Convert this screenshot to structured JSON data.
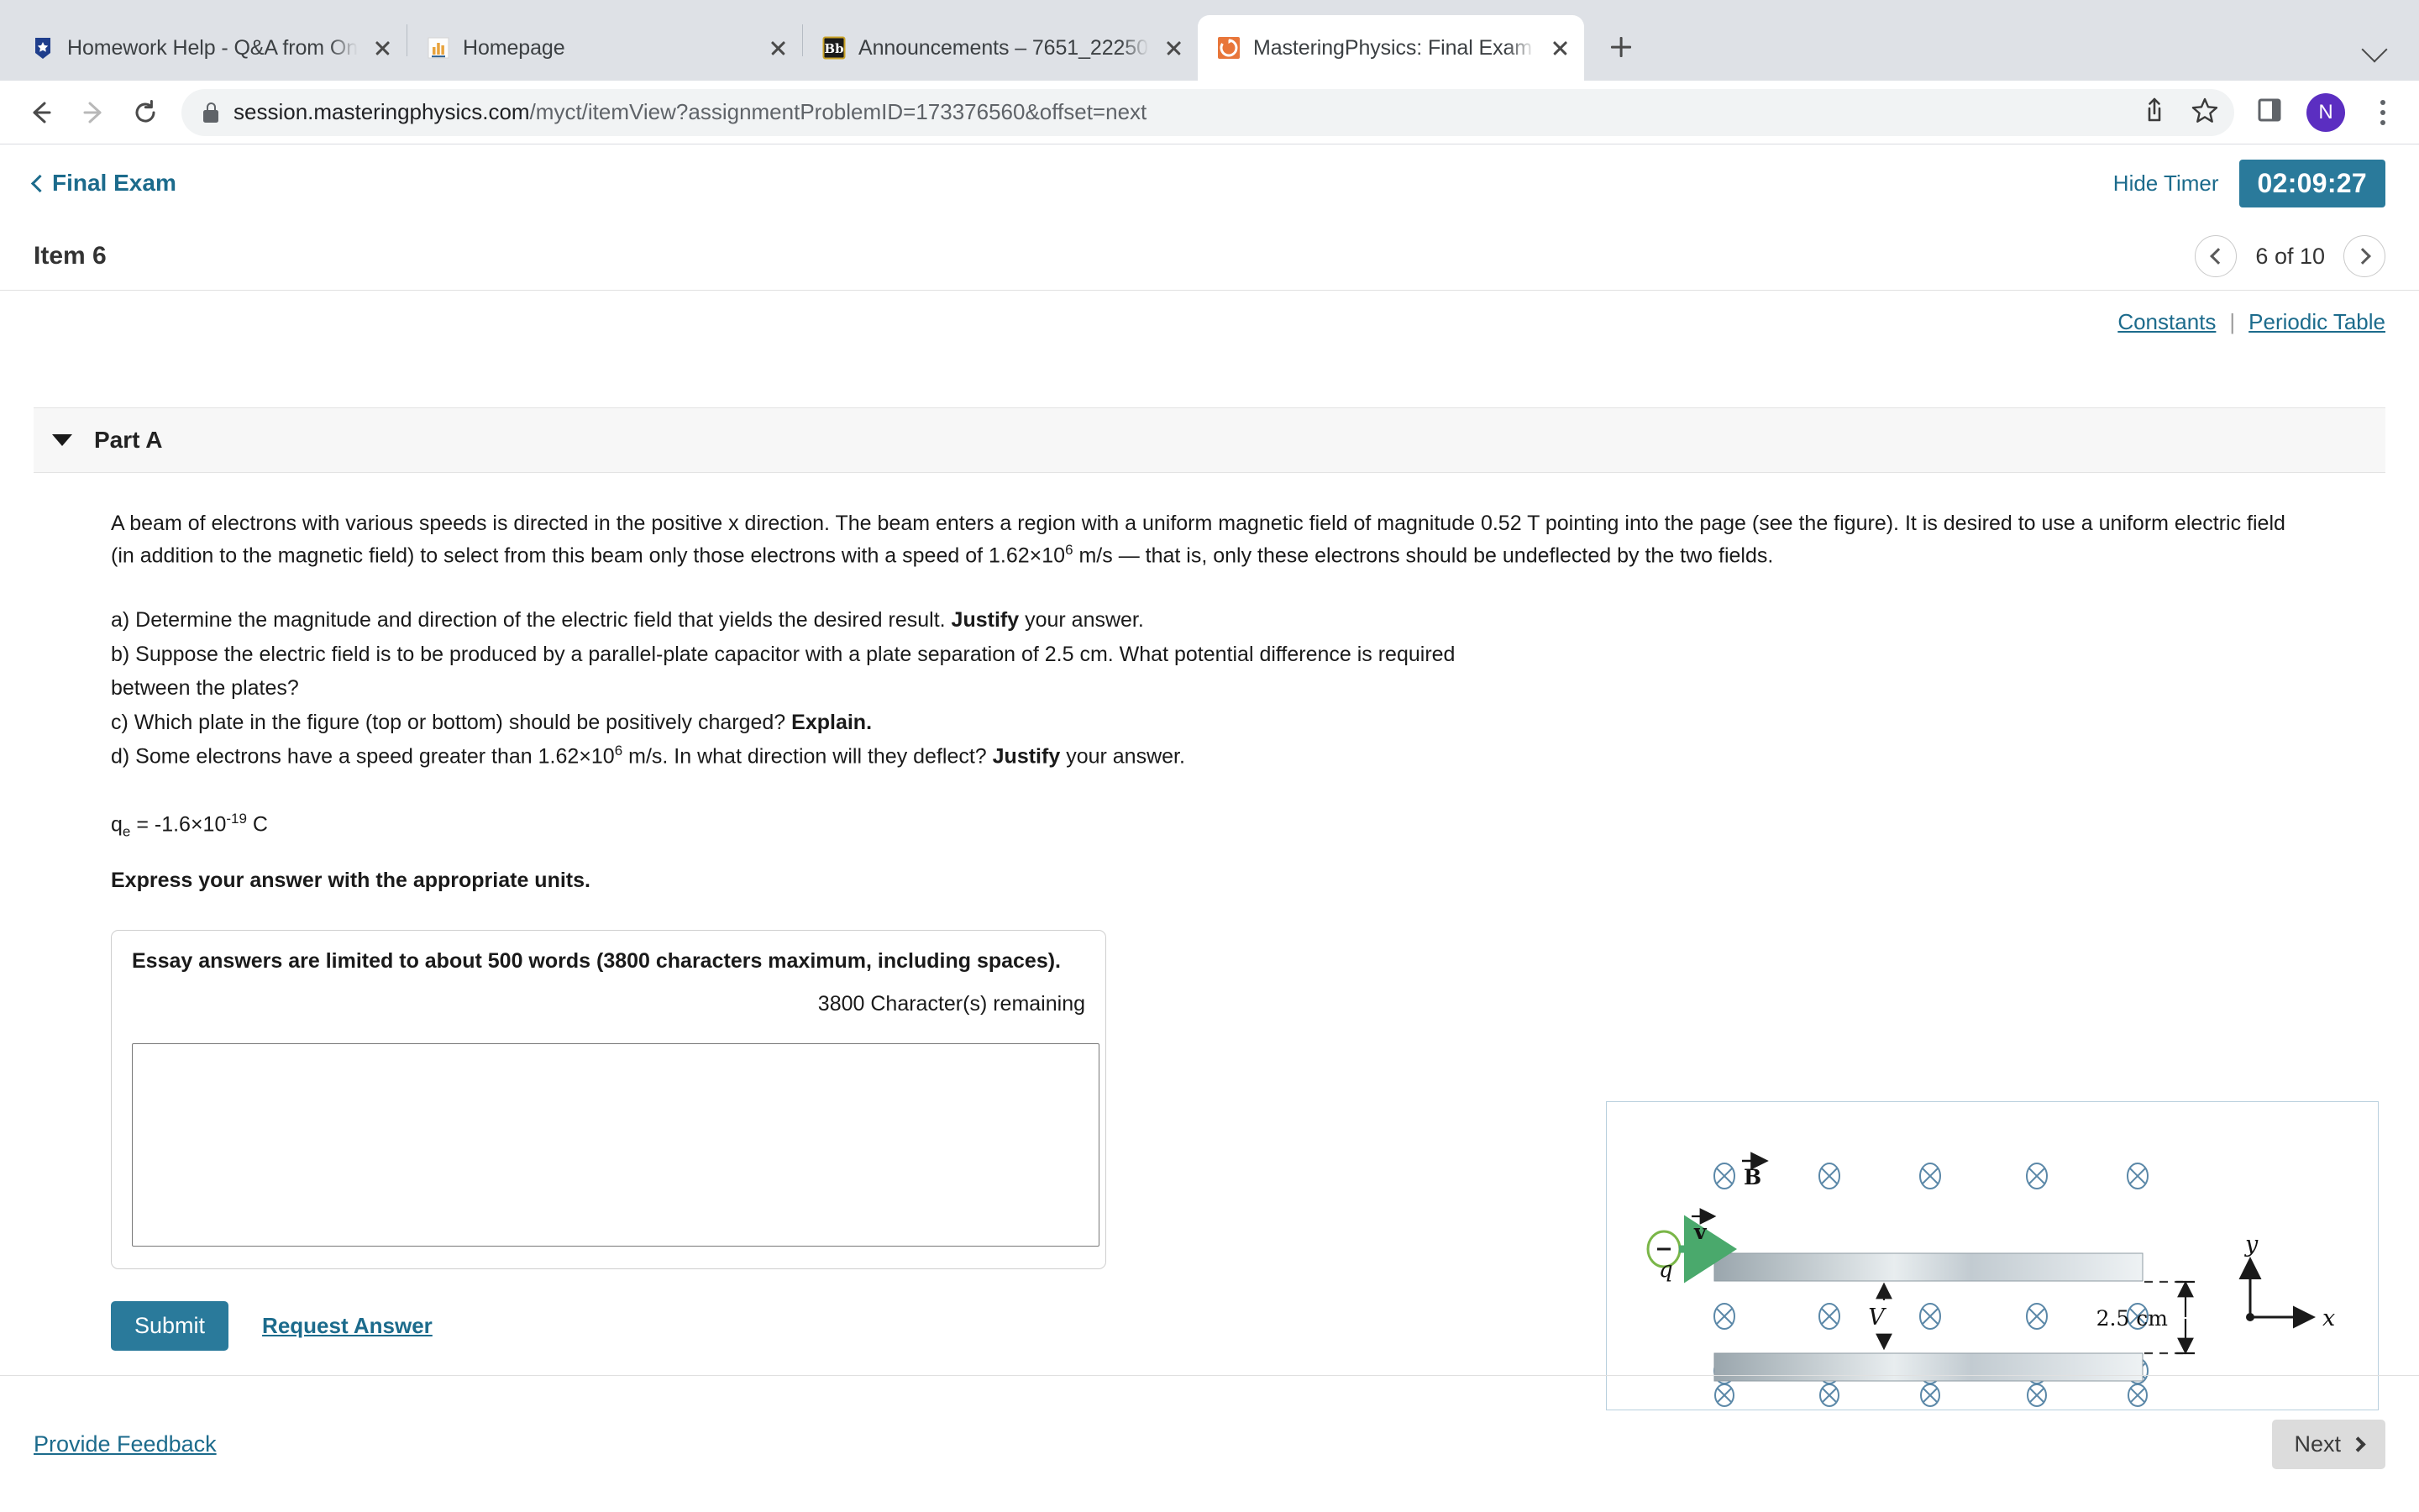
{
  "browser": {
    "tabs": [
      {
        "title": "Homework Help - Q&A from On",
        "favicon": "brainly-shield-icon",
        "active": false
      },
      {
        "title": "Homepage",
        "favicon": "chart-bars-icon",
        "active": false
      },
      {
        "title": "Announcements – 7651_22250",
        "favicon": "blackboard-bb-icon",
        "active": false
      },
      {
        "title": "MasteringPhysics: Final Exam",
        "favicon": "mastering-physics-icon",
        "active": true
      }
    ],
    "new_tab_label": "+",
    "tab_list_chevron": "chevron-down-icon",
    "url_secure": "session.masteringphysics.com",
    "url_path": "/myct/itemView?assignmentProblemID=173376560&offset=next",
    "omnibox_icons": [
      "share-icon",
      "star-icon"
    ],
    "toolbar_icons": [
      "sidepanel-icon"
    ],
    "profile_initial": "N",
    "profile_color": "#5b2ec1",
    "menu_icon": "kebab-menu-icon"
  },
  "header": {
    "back_label": "Final Exam",
    "hide_timer_label": "Hide Timer",
    "timer": "02:09:27",
    "timer_color": "#2a7a9b",
    "item_title": "Item 6",
    "pager_label": "6 of 10",
    "prev_icon": "chevron-left-icon",
    "next_icon": "chevron-right-icon"
  },
  "tools": {
    "constants_label": "Constants",
    "divider": "|",
    "periodic_table_label": "Periodic Table"
  },
  "part": {
    "caret_icon": "caret-down-icon",
    "label": "Part A"
  },
  "question": {
    "intro_line1": "A beam of electrons with various speeds is directed in the positive x direction. The beam enters a region with a uniform magnetic field of magnitude 0.52 T pointing into the page (see the figure). It is desired to use a uniform electric field",
    "intro_line2_pre": "(in addition to the magnetic field) to select from this beam only those electrons with a speed of 1.62×10",
    "intro_line2_exp": "6",
    "intro_line2_post": " m/s — that is, only these electrons should be undeflected by the two fields.",
    "items": [
      {
        "text_pre": "a) Determine the magnitude and direction of the electric field that yields the desired result. ",
        "bold": "Justify",
        "text_post": " your answer."
      },
      {
        "text_pre": "b) Suppose the electric field is to be produced by a parallel-plate capacitor with a plate separation of 2.5 cm. What potential difference is required between the plates?",
        "bold": "",
        "text_post": ""
      },
      {
        "text_pre": "c) Which plate in the figure (top or bottom) should be positively charged? ",
        "bold": "Explain.",
        "text_post": ""
      },
      {
        "text_pre": "d) Some electrons have a speed greater than 1.62×10",
        "sup": "6",
        "mid": " m/s. In what direction will they deflect? ",
        "bold": "Justify",
        "text_post": " your answer."
      }
    ],
    "constant_symbol": "q",
    "constant_sub": "e",
    "constant_value": " = -1.6×10",
    "constant_exp": "-19",
    "constant_unit": " C",
    "express_note": "Express your answer with the appropriate units."
  },
  "figure": {
    "b_field_label": "B",
    "velocity_label": "v",
    "charge_label": "q",
    "charge_sign": "-",
    "voltage_label": "V",
    "separation_label": "2.5 cm",
    "axis_y_label": "y",
    "axis_x_label": "x",
    "field_symbol": "⊗",
    "field_color": "#5b88a8",
    "plate_color": "#9aa6ad",
    "velocity_color": "#4aa96c",
    "charge_ring_color": "#7ab648"
  },
  "essay": {
    "note": "Essay answers are limited to about 500 words (3800 characters maximum, including spaces).",
    "remaining": "3800 Character(s) remaining",
    "value": "",
    "placeholder": ""
  },
  "actions": {
    "submit_label": "Submit",
    "request_answer_label": "Request Answer"
  },
  "footer": {
    "feedback_label": "Provide Feedback",
    "next_label": "Next",
    "next_icon": "chevron-right-icon"
  }
}
